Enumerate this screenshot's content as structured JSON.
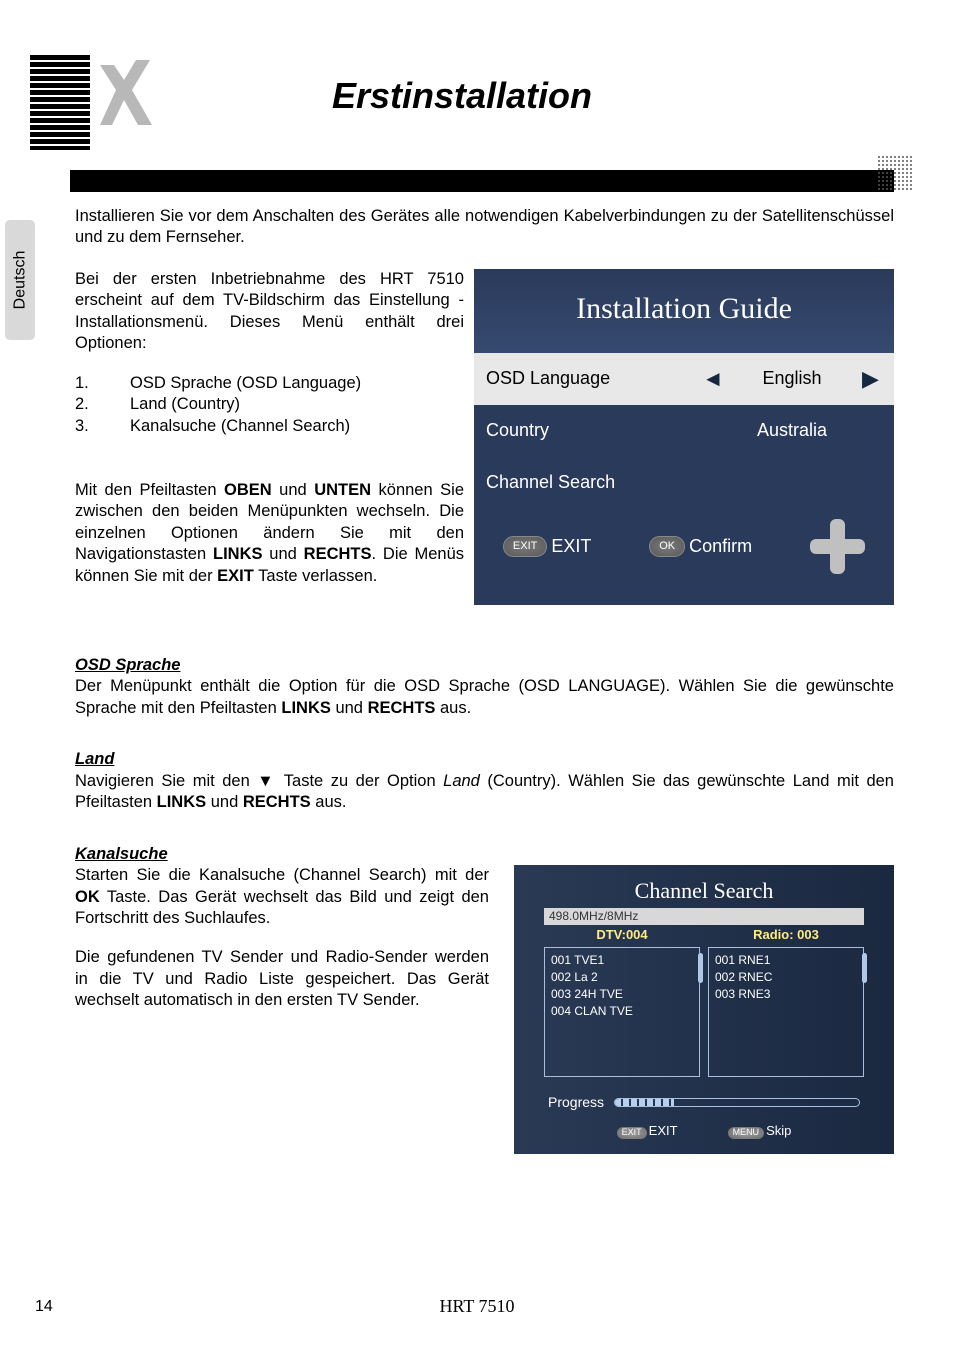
{
  "page": {
    "title": "Erstinstallation",
    "lang_tab": "Deutsch",
    "page_number": "14",
    "footer_model": "HRT 7510"
  },
  "intro": "Installieren Sie vor dem Anschalten des Gerätes alle notwendigen Kabelverbindungen zu der Satellitenschüssel und zu dem Fernseher.",
  "p1": "Bei der ersten Inbetriebnahme des HRT 7510 erscheint auf dem TV-Bildschirm das Einstellung - Installationsmenü. Dieses Menü enthält drei Optionen:",
  "list": {
    "i1": {
      "n": "1.",
      "t": "OSD Sprache (OSD Language)"
    },
    "i2": {
      "n": "2.",
      "t": "Land (Country)"
    },
    "i3": {
      "n": "3.",
      "t": "Kanalsuche (Channel Search)"
    }
  },
  "p2a": "Mit den Pfeiltasten ",
  "p2b": " und ",
  "p2c": " können Sie zwischen den beiden Menüpunkten wechseln. Die einzelnen Optionen ändern Sie mit den Navigationstasten ",
  "p2d": " und ",
  "p2e": ". Die Menüs können Sie mit der ",
  "p2f": " Taste verlassen.",
  "b": {
    "oben": "OBEN",
    "unten": "UNTEN",
    "links": "LINKS",
    "rechts": "RECHTS",
    "exit": "EXIT",
    "ok": "OK"
  },
  "guide": {
    "title": "Installation Guide",
    "r1_label": "OSD Language",
    "r1_value": "English",
    "r2_label": "Country",
    "r2_value": "Australia",
    "r3_label": "Channel Search",
    "exit_btn": "EXIT",
    "exit_label": "EXIT",
    "ok_btn": "OK",
    "ok_label": "Confirm"
  },
  "sec_osd": {
    "h": "OSD Sprache",
    "p_a": "Der Menüpunkt enthält die Option für die OSD Sprache (OSD LANGUAGE). Wählen Sie die gewünschte Sprache mit den Pfeiltasten ",
    "p_b": " und ",
    "p_c": " aus."
  },
  "sec_land": {
    "h": "Land",
    "p_a": "Navigieren Sie mit den ▼ Taste zu der Option ",
    "p_b": " (Country). Wählen Sie das gewünschte Land mit den Pfeiltasten ",
    "p_c": " und ",
    "p_d": " aus.",
    "italic": "Land"
  },
  "sec_kanal": {
    "h": "Kanalsuche",
    "p1_a": "Starten Sie die Kanalsuche (Channel Search) mit der ",
    "p1_b": " Taste. Das Gerät wechselt das Bild und zeigt den Fortschritt des Suchlaufes.",
    "p2": "Die gefundenen TV Sender und Radio-Sender werden in die TV und Radio Liste gespeichert. Das Gerät wechselt automatisch in den ersten TV Sender."
  },
  "search": {
    "title": "Channel Search",
    "freq": "498.0MHz/8MHz",
    "dtv_h": "DTV:004",
    "radio_h": "Radio: 003",
    "tv": [
      "001 TVE1",
      "002 La 2",
      "003 24H TVE",
      "004 CLAN TVE"
    ],
    "radio": [
      "001 RNE1",
      "002 RNEC",
      "003 RNE3"
    ],
    "progress_label": "Progress",
    "exit_btn": "EXIT",
    "exit_label": "EXIT",
    "skip_btn": "MENU",
    "skip_label": "Skip"
  }
}
